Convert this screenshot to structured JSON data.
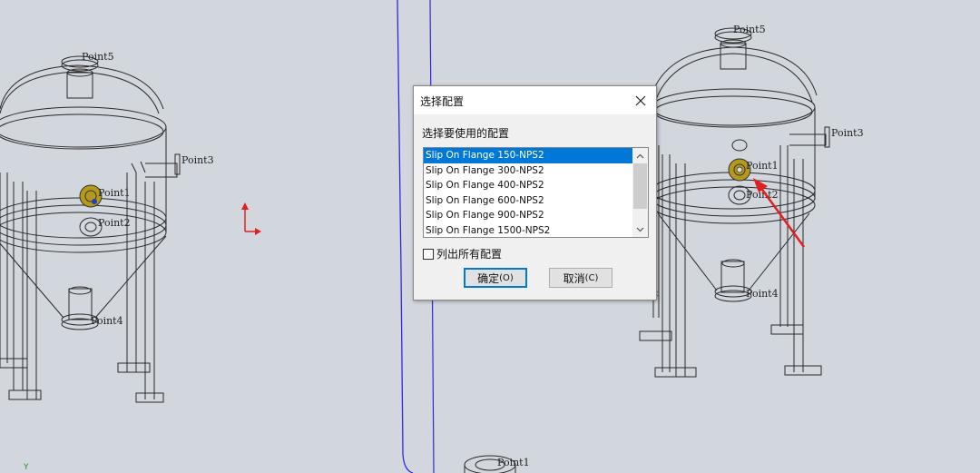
{
  "viewport": {
    "left_labels": [
      "Point5",
      "Point3",
      "Point1",
      "Point2",
      "Point4"
    ],
    "right_labels": [
      "Point5",
      "Point3",
      "Point1",
      "Point2",
      "Point4"
    ],
    "bottom_label": "Point1",
    "axis_label": "Y"
  },
  "dialog": {
    "title": "选择配置",
    "prompt": "选择要使用的配置",
    "configurations": [
      "Slip On Flange 150-NPS2",
      "Slip On Flange 300-NPS2",
      "Slip On Flange 400-NPS2",
      "Slip On Flange 600-NPS2",
      "Slip On Flange 900-NPS2",
      "Slip On Flange 1500-NPS2"
    ],
    "selected_configuration": "Slip On Flange 150-NPS2",
    "list_all_label": "列出所有配置",
    "list_all_checked": false,
    "ok_label": "确定",
    "ok_accel": "(O)",
    "cancel_label": "取消",
    "cancel_accel": "(C)"
  },
  "colors": {
    "background": "#d2d6dd",
    "selection": "#0078d7",
    "annotation_arrow": "#e02020",
    "divider_line": "#2b2bd9"
  }
}
